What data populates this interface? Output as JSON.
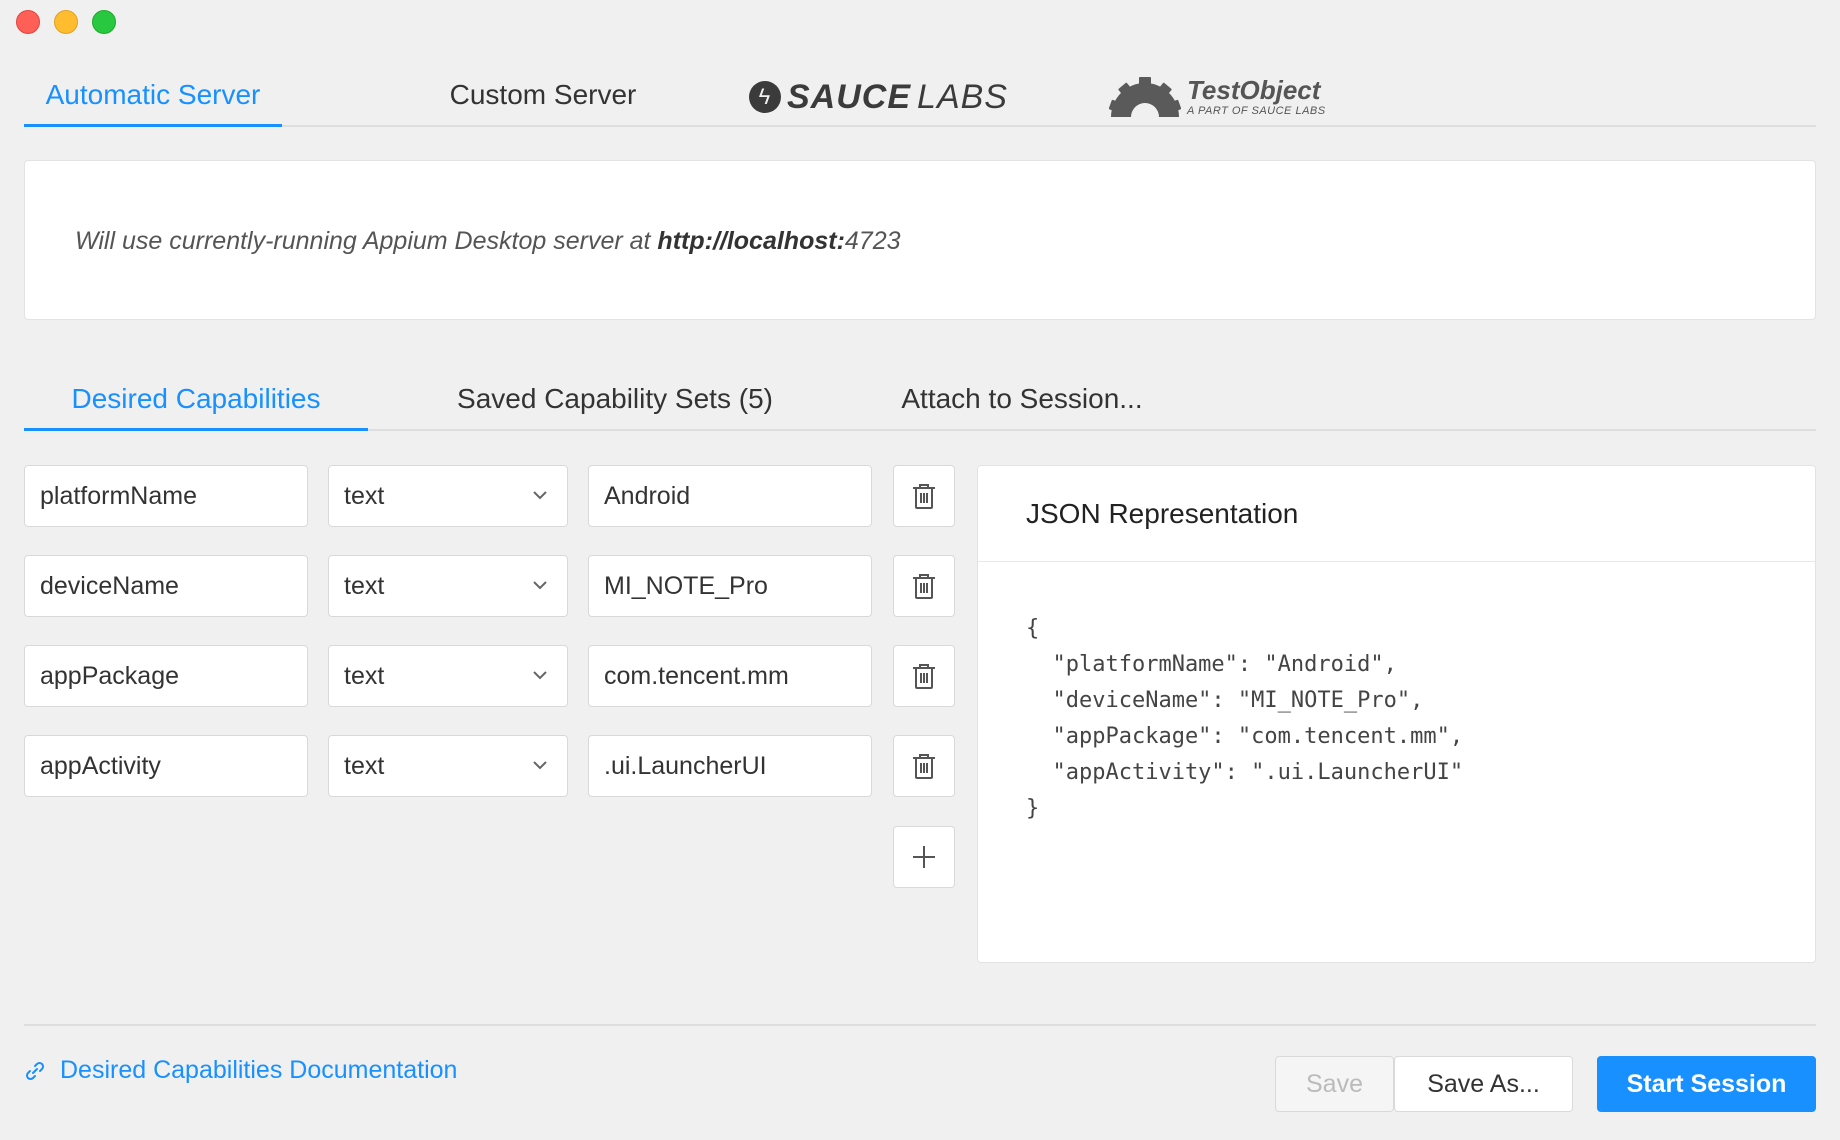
{
  "server_tabs": [
    {
      "label": "Automatic Server",
      "active": true
    },
    {
      "label": "Custom Server",
      "active": false
    }
  ],
  "logos": {
    "saucelabs_bold": "SAUCE",
    "saucelabs_light": "LABS",
    "testobject_title": "TestObject",
    "testobject_sub": "A PART OF SAUCE LABS"
  },
  "server_info": {
    "prefix": "Will use currently-running Appium Desktop server at ",
    "url_bold": "http://localhost:",
    "port": "4723"
  },
  "cap_tabs": [
    {
      "label": "Desired Capabilities",
      "active": true
    },
    {
      "label": "Saved Capability Sets (5)",
      "active": false
    },
    {
      "label": "Attach to Session...",
      "active": false
    }
  ],
  "capabilities": [
    {
      "name": "platformName",
      "type": "text",
      "value": "Android"
    },
    {
      "name": "deviceName",
      "type": "text",
      "value": "MI_NOTE_Pro"
    },
    {
      "name": "appPackage",
      "type": "text",
      "value": "com.tencent.mm"
    },
    {
      "name": "appActivity",
      "type": "text",
      "value": ".ui.LauncherUI"
    }
  ],
  "json_panel": {
    "title": "JSON Representation",
    "code": "{\n  \"platformName\": \"Android\",\n  \"deviceName\": \"MI_NOTE_Pro\",\n  \"appPackage\": \"com.tencent.mm\",\n  \"appActivity\": \".ui.LauncherUI\"\n}"
  },
  "footer": {
    "doc_link": "Desired Capabilities Documentation",
    "save": "Save",
    "save_as": "Save As...",
    "start_session": "Start Session"
  },
  "colors": {
    "accent": "#1890ff",
    "close": "#fe5f57",
    "minimize": "#febc2e",
    "maximize": "#28c840"
  }
}
